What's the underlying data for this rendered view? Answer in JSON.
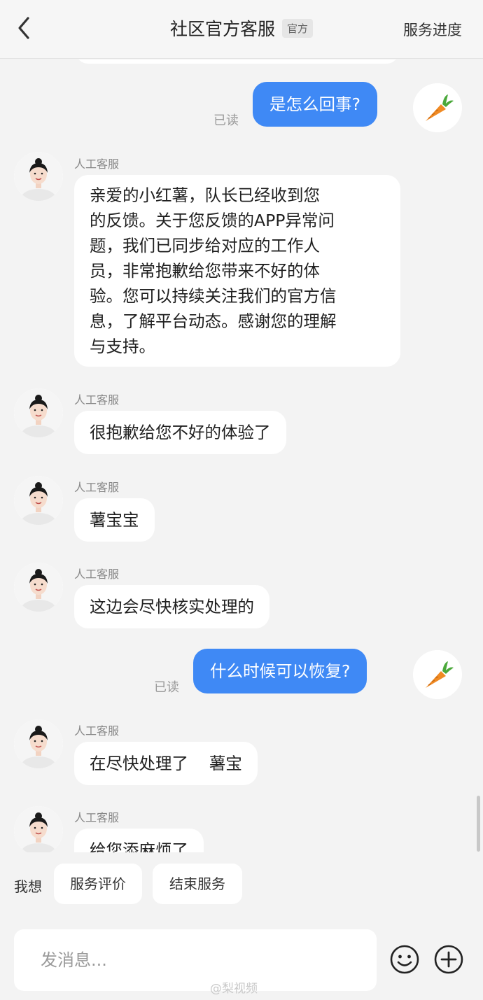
{
  "header": {
    "title": "社区官方客服",
    "official_tag": "官方",
    "progress_label": "服务进度"
  },
  "messages": [
    {
      "type": "out",
      "text": "是怎么回事?",
      "read": "已读"
    },
    {
      "type": "in",
      "sender": "人工客服",
      "lines": [
        "亲爱的小红薯，队长已经收到您",
        "的反馈。关于您反馈的APP异常问",
        "题，我们已同步给对应的工作人",
        "员，非常抱歉给您带来不好的体",
        "验。您可以持续关注我们的官方信",
        "息，了解平台动态。感谢您的理解",
        "与支持。"
      ]
    },
    {
      "type": "in",
      "sender": "人工客服",
      "text": "很抱歉给您不好的体验了"
    },
    {
      "type": "in",
      "sender": "人工客服",
      "text": "薯宝宝"
    },
    {
      "type": "in",
      "sender": "人工客服",
      "text": "这边会尽快核实处理的"
    },
    {
      "type": "out",
      "text": "什么时候可以恢复?",
      "read": "已读"
    },
    {
      "type": "in",
      "sender": "人工客服",
      "text": "在尽快处理了    薯宝"
    },
    {
      "type": "in",
      "sender": "人工客服",
      "text": "给您添麻烦了"
    }
  ],
  "quick": {
    "label": "我想",
    "chips": [
      "服务评价",
      "结束服务"
    ]
  },
  "input": {
    "placeholder": "发消息..."
  },
  "watermark": "@梨视频",
  "icons": {
    "back": "chevron-left-icon",
    "emoji": "smiley-icon",
    "add": "plus-circle-icon",
    "user_avatar": "carrot-icon",
    "agent_avatar": "agent-portrait-icon"
  },
  "colors": {
    "outgoing_bubble": "#3f89f5",
    "background": "#f3f3f3"
  }
}
